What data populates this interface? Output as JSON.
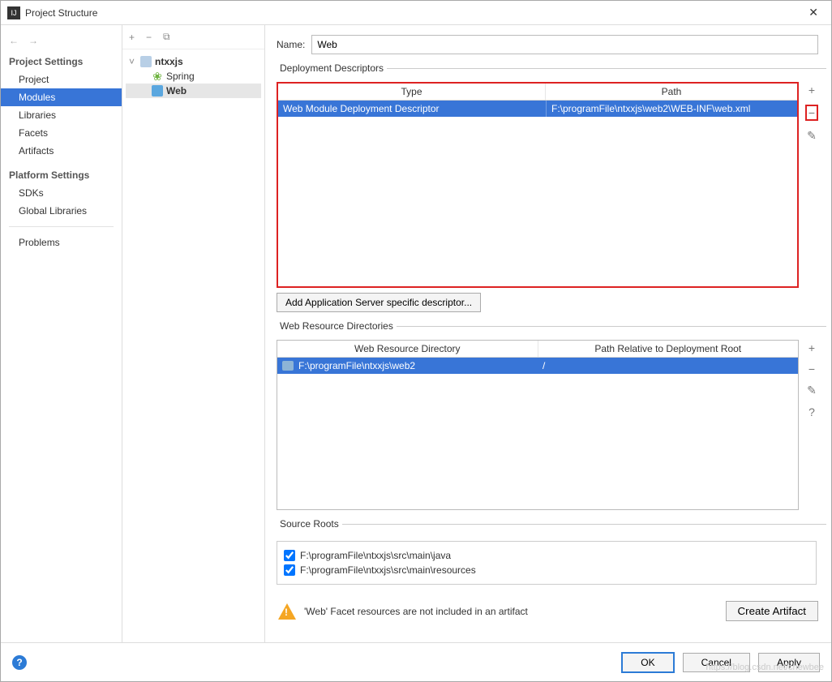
{
  "window": {
    "title": "Project Structure"
  },
  "nav": {
    "back": "←",
    "forward": "→"
  },
  "sidebar": {
    "projectSettings": {
      "label": "Project Settings",
      "items": [
        "Project",
        "Modules",
        "Libraries",
        "Facets",
        "Artifacts"
      ],
      "selectedIndex": 1
    },
    "platformSettings": {
      "label": "Platform Settings",
      "items": [
        "SDKs",
        "Global Libraries"
      ]
    },
    "problems": "Problems"
  },
  "treeToolbar": {
    "add": "+",
    "remove": "−",
    "copy": "⧉"
  },
  "tree": {
    "root": "ntxxjs",
    "children": [
      {
        "label": "Spring",
        "icon": "spring"
      },
      {
        "label": "Web",
        "icon": "web",
        "selected": true
      }
    ]
  },
  "name": {
    "label": "Name:",
    "value": "Web"
  },
  "dd": {
    "legend": "Deployment Descriptors",
    "headers": [
      "Type",
      "Path"
    ],
    "rows": [
      {
        "type": "Web Module Deployment Descriptor",
        "path": "F:\\programFile\\ntxxjs\\web2\\WEB-INF\\web.xml"
      }
    ],
    "addAppServer": "Add Application Server specific descriptor...",
    "sideBtns": {
      "add": "+",
      "remove": "−",
      "edit": "✎"
    }
  },
  "wr": {
    "legend": "Web Resource Directories",
    "headers": [
      "Web Resource Directory",
      "Path Relative to Deployment Root"
    ],
    "rows": [
      {
        "dir": "F:\\programFile\\ntxxjs\\web2",
        "rel": "/"
      }
    ],
    "sideBtns": {
      "add": "+",
      "remove": "−",
      "edit": "✎",
      "help": "?"
    }
  },
  "sr": {
    "legend": "Source Roots",
    "items": [
      "F:\\programFile\\ntxxjs\\src\\main\\java",
      "F:\\programFile\\ntxxjs\\src\\main\\resources"
    ]
  },
  "warning": {
    "text": "'Web' Facet resources are not included in an artifact",
    "createArtifact": "Create Artifact"
  },
  "footer": {
    "ok": "OK",
    "cancel": "Cancel",
    "apply": "Apply"
  },
  "watermark": "https://blog.csdn.net/chewbee"
}
